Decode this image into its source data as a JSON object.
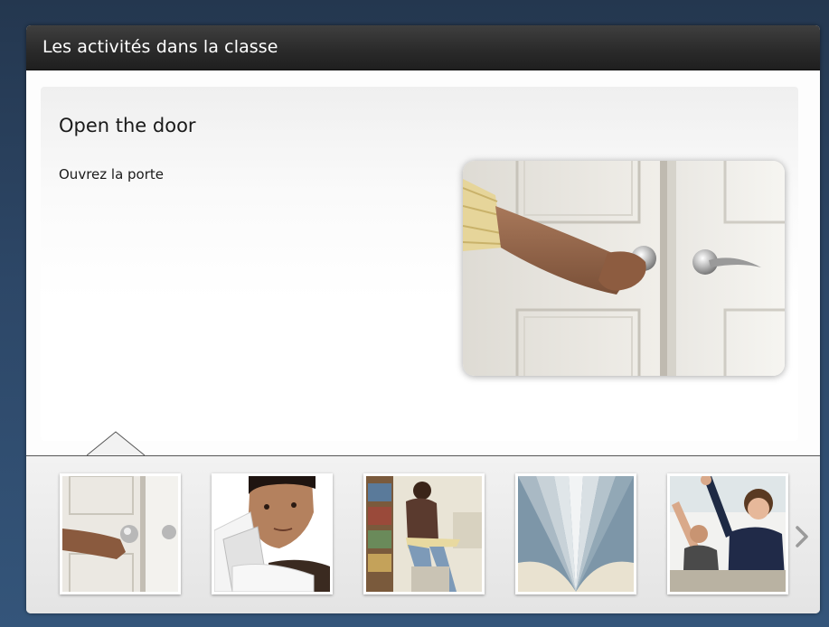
{
  "header": {
    "title": "Les activités dans la classe"
  },
  "card": {
    "heading": "Open the door",
    "translation": "Ouvrez la porte",
    "image_icon": "door-handle-photo"
  },
  "thumbnails": [
    {
      "icon": "door-handle-photo",
      "selected": true
    },
    {
      "icon": "student-papers-photo",
      "selected": false
    },
    {
      "icon": "student-reading-photo",
      "selected": false
    },
    {
      "icon": "open-book-photo",
      "selected": false
    },
    {
      "icon": "raised-hands-photo",
      "selected": false
    }
  ],
  "controls": {
    "next_icon": "chevron-right-icon"
  },
  "colors": {
    "background": "#2d4767",
    "title_bar": "#2b2b2b",
    "panel": "#fdfdfd",
    "thumb_strip": "#e8e8e8"
  }
}
